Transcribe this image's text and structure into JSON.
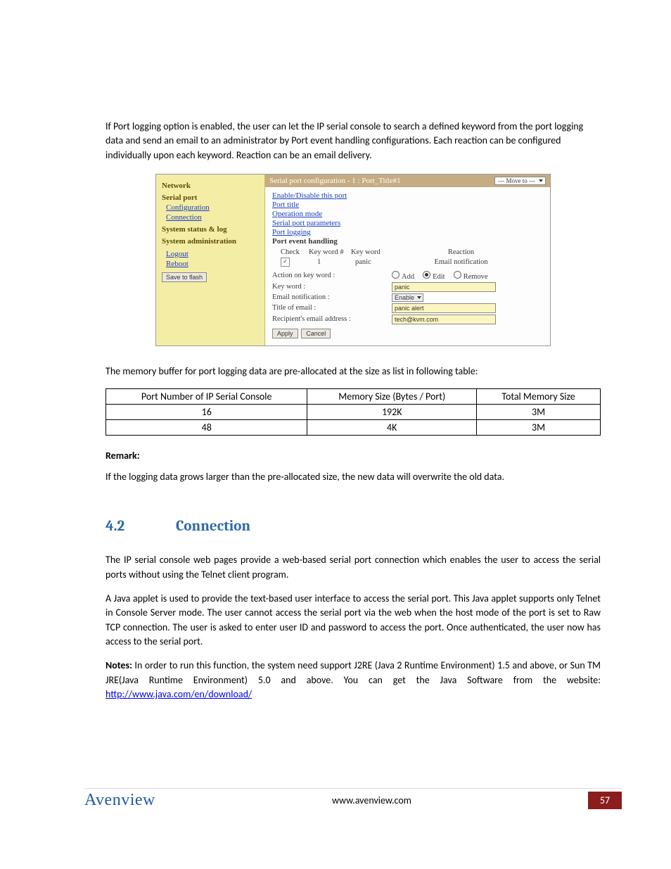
{
  "intro_para": "If Port logging option is enabled, the user can let the IP serial console to search a defined keyword from the port logging data and send an email to an administrator by Port event handling configurations. Each reaction can be configured individually upon each keyword. Reaction can be an email delivery.",
  "screenshot": {
    "left": {
      "groups": {
        "network": "Network",
        "serial_port": "Serial port",
        "configuration": "Configuration",
        "connection": "Connection",
        "system_status": "System status & log",
        "system_admin": "System administration",
        "logout": "Logout",
        "reboot": "Reboot",
        "save_btn": "Save to flash"
      }
    },
    "titlebar": {
      "title": "Serial port configuration - 1 : Port_Title#1",
      "move_to": "--- Move to ---"
    },
    "config_links": {
      "enable": "Enable/Disable this port",
      "port_title": "Port title",
      "operation_mode": "Operation mode",
      "serial_params": "Serial port parameters",
      "port_logging": "Port logging",
      "port_event": "Port event handling"
    },
    "kw_header": {
      "check": "Check",
      "kwnum": "Key word #",
      "kw": "Key word",
      "reaction": "Reaction"
    },
    "kw_row": {
      "num": "1",
      "word": "panic",
      "reaction": "Email notification"
    },
    "form": {
      "action_label": "Action on key word :",
      "add": "Add",
      "edit": "Edit",
      "remove": "Remove",
      "kw_label": "Key word :",
      "kw_value": "panic",
      "email_notif_label": "Email notification :",
      "email_notif_value": "Enable",
      "title_label": "Title of email :",
      "title_value": "panic alert",
      "recip_label": "Recipient's email address :",
      "recip_value": "tech@kvm.com",
      "apply": "Apply",
      "cancel": "Cancel"
    }
  },
  "mem_para": "The memory buffer for port logging data are pre-allocated at the size as list in following table:",
  "mem_table": {
    "headers": [
      "Port Number of IP Serial Console",
      "Memory Size (Bytes / Port)",
      "Total Memory Size"
    ],
    "rows": [
      [
        "16",
        "192K",
        "3M"
      ],
      [
        "48",
        "4K",
        "3M"
      ]
    ]
  },
  "remark_h": "Remark:",
  "remark_p": "If the logging data grows larger than the pre-allocated size, the new data will overwrite the old data.",
  "section": {
    "num": "4.2",
    "title": "Connection"
  },
  "conn_p1": "The IP serial console web pages provide a web-based serial port connection which enables the user to access the serial ports without using the Telnet client program.",
  "conn_p2": "A Java applet is used to provide the text-based user interface to access the serial port. This Java applet supports only Telnet in Console Server mode. The user cannot access the serial port via the web when the host mode of the port is set to Raw TCP connection. The user is asked to enter user ID and password to access the port. Once authenticated, the user now has access to the serial port.",
  "notes_label": "Notes:",
  "notes_text": " In order to run this function, the system need support J2RE (Java 2 Runtime Environment) 1.5 and above, or Sun TM JRE(Java Runtime Environment) 5.0 and above. You can get the Java Software from the website: ",
  "notes_link": "http://www.java.com/en/download/",
  "footer": {
    "logo": "Avenview",
    "site": "www.avenview.com",
    "page": "57"
  }
}
